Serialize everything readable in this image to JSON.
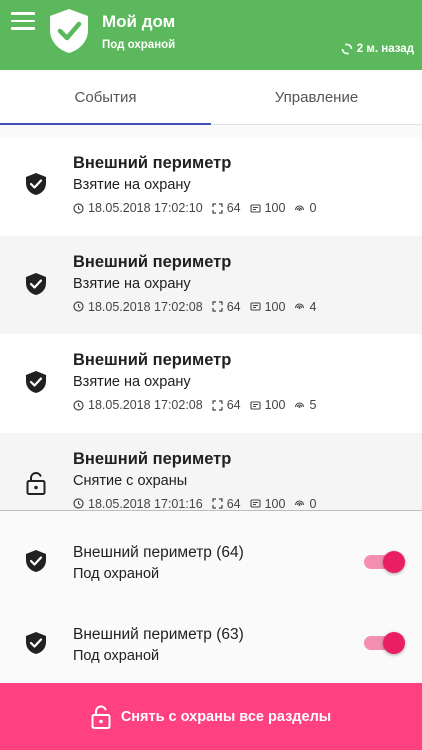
{
  "header": {
    "title": "Мой дом",
    "status": "Под охраной",
    "sync_time": "2 м. назад",
    "color": "#5cb85c"
  },
  "tabs": [
    {
      "label": "События",
      "active": true
    },
    {
      "label": "Управление",
      "active": false
    }
  ],
  "events": [
    {
      "icon": "shield-check-icon",
      "title": "Внешний периметр",
      "action": "Взятие на охрану",
      "datetime": "18.05.2018 17:02:10",
      "zone": "64",
      "code": "100",
      "signal": "0"
    },
    {
      "icon": "shield-check-icon",
      "title": "Внешний периметр",
      "action": "Взятие на охрану",
      "datetime": "18.05.2018 17:02:08",
      "zone": "64",
      "code": "100",
      "signal": "4"
    },
    {
      "icon": "shield-check-icon",
      "title": "Внешний периметр",
      "action": "Взятие на охрану",
      "datetime": "18.05.2018 17:02:08",
      "zone": "64",
      "code": "100",
      "signal": "5"
    },
    {
      "icon": "lock-open-icon",
      "title": "Внешний периметр",
      "action": "Снятие с охраны",
      "datetime": "18.05.2018 17:01:16",
      "zone": "64",
      "code": "100",
      "signal": "0"
    }
  ],
  "zones": [
    {
      "name": "Внешний периметр (64)",
      "state": "Под охраной",
      "armed": true
    },
    {
      "name": "Внешний периметр (63)",
      "state": "Под охраной",
      "armed": true
    }
  ],
  "disarm_all_button": {
    "label": "Снять с охраны все разделы",
    "color": "#ff4081"
  }
}
